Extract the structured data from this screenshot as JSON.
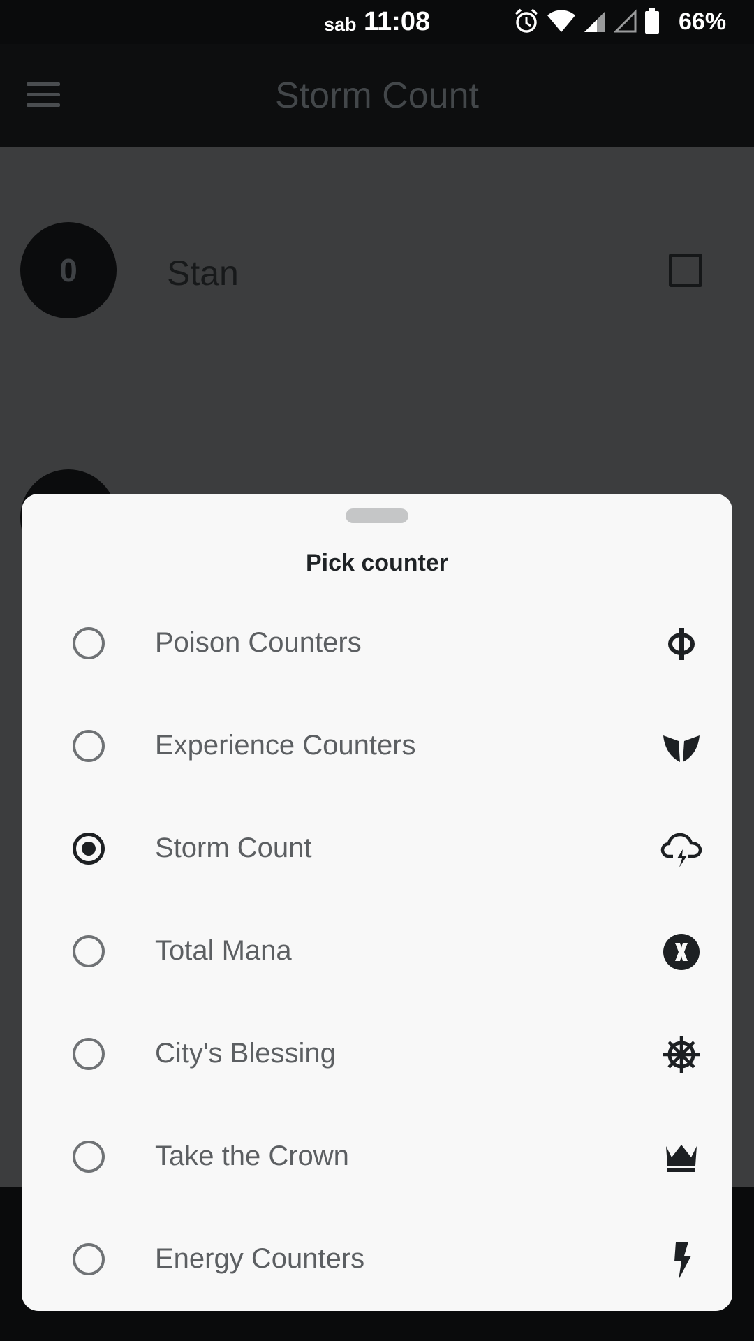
{
  "status_bar": {
    "day": "sab",
    "time": "11:08",
    "battery": "66%",
    "icons": [
      "alarm-icon",
      "wifi-icon",
      "cell-signal-icon",
      "cell-signal-empty-icon",
      "battery-icon"
    ]
  },
  "app_bar": {
    "title": "Storm Count",
    "menu_icon": "menu-icon"
  },
  "player": {
    "count": "0",
    "name": "Stan"
  },
  "sheet": {
    "title": "Pick counter",
    "options": [
      {
        "label": "Poison Counters",
        "icon": "phi-icon",
        "selected": false
      },
      {
        "label": "Experience Counters",
        "icon": "experience-wings-icon",
        "selected": false
      },
      {
        "label": "Storm Count",
        "icon": "storm-cloud-icon",
        "selected": true
      },
      {
        "label": "Total Mana",
        "icon": "mana-x-icon",
        "selected": false
      },
      {
        "label": "City's Blessing",
        "icon": "ship-wheel-icon",
        "selected": false
      },
      {
        "label": "Take the Crown",
        "icon": "crown-icon",
        "selected": false
      },
      {
        "label": "Energy Counters",
        "icon": "lightning-icon",
        "selected": false
      }
    ]
  },
  "colors": {
    "sheet_bg": "#f8f8f8",
    "scrim": "#3c3d3e",
    "icon": "#1d2023"
  }
}
